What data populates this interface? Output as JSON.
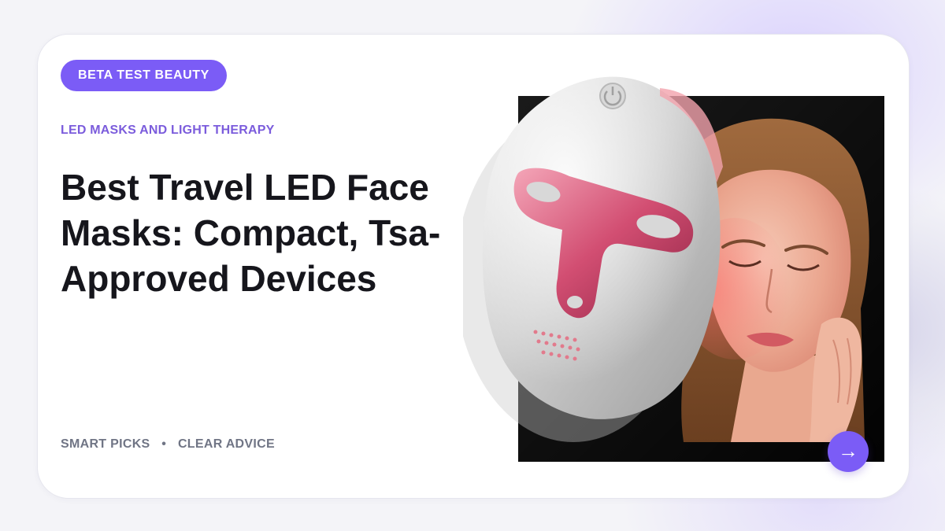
{
  "brand": {
    "name": "BETA TEST BEAUTY",
    "accent_color": "#7b5cf6"
  },
  "article": {
    "category": "LED MASKS AND LIGHT THERAPY",
    "headline": "Best Travel LED Face Masks: Compact, Tsa-Approved Devices"
  },
  "tagline": {
    "left": "SMART PICKS",
    "separator": "•",
    "right": "CLEAR ADVICE"
  },
  "actions": {
    "next_icon": "→"
  }
}
